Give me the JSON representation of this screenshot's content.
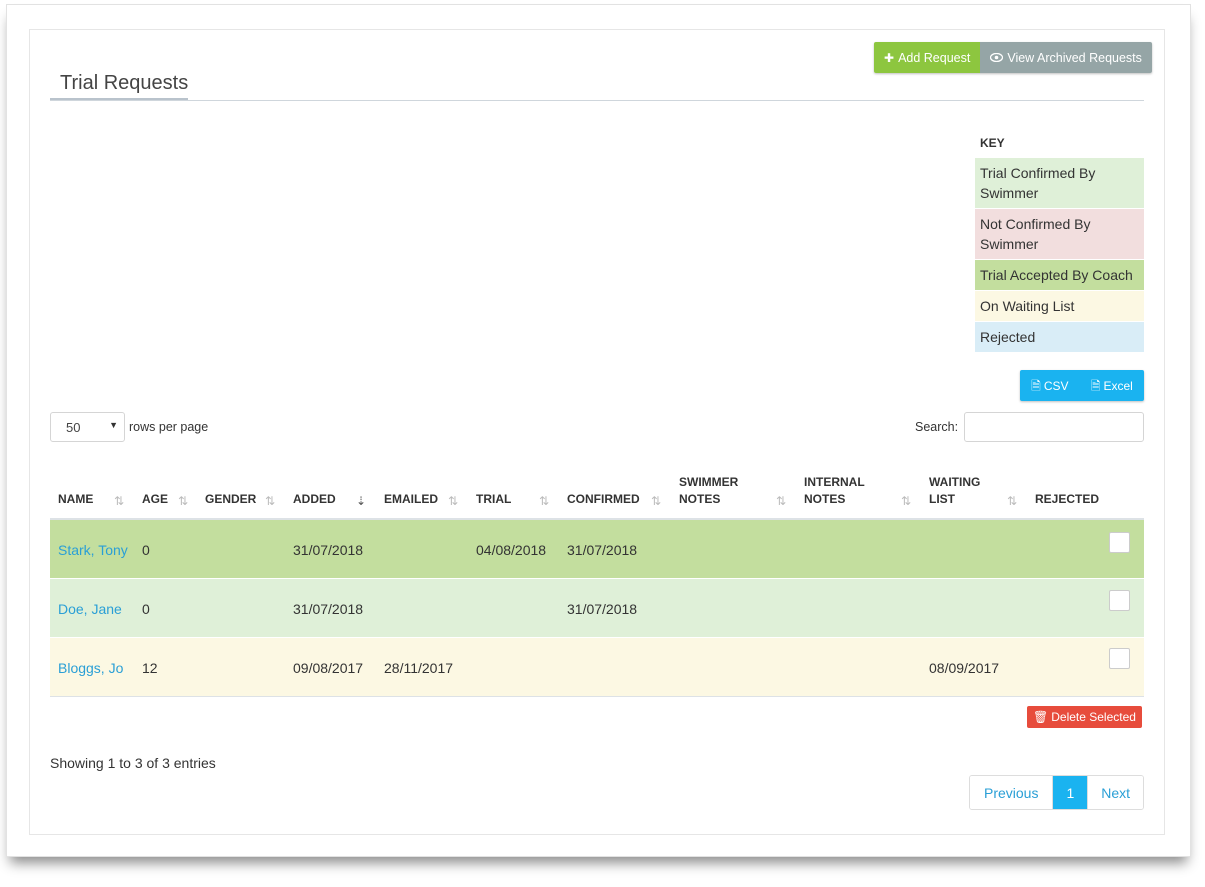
{
  "header": {
    "title": "Trial Requests",
    "add_request": "Add Request",
    "view_archived": "View Archived Requests"
  },
  "key": {
    "title": "KEY",
    "items": [
      {
        "label": "Trial Confirmed By Swimmer",
        "color": "#dff0d8"
      },
      {
        "label": "Not Confirmed By Swimmer",
        "color": "#f2dede"
      },
      {
        "label": "Trial Accepted By Coach",
        "color": "#c3de9e"
      },
      {
        "label": "On Waiting List",
        "color": "#fcf8e3"
      },
      {
        "label": "Rejected",
        "color": "#d9edf7"
      }
    ]
  },
  "export": {
    "csv": "CSV",
    "excel": "Excel"
  },
  "controls": {
    "rows_per_page_value": "50",
    "rows_per_page_label": "rows per page",
    "search_label": "Search:"
  },
  "table": {
    "columns": [
      "NAME",
      "AGE",
      "GENDER",
      "ADDED",
      "EMAILED",
      "TRIAL",
      "CONFIRMED",
      "SWIMMER NOTES",
      "INTERNAL NOTES",
      "WAITING LIST",
      "REJECTED"
    ],
    "rows": [
      {
        "name": "Stark, Tony",
        "age": "0",
        "gender": "",
        "added": "31/07/2018",
        "emailed": "",
        "trial": "04/08/2018",
        "confirmed": "31/07/2018",
        "swimmer_notes": "",
        "internal_notes": "",
        "waiting_list": "",
        "color": "#c3de9e"
      },
      {
        "name": "Doe, Jane",
        "age": "0",
        "gender": "",
        "added": "31/07/2018",
        "emailed": "",
        "trial": "",
        "confirmed": "31/07/2018",
        "swimmer_notes": "",
        "internal_notes": "",
        "waiting_list": "",
        "color": "#dff0d8"
      },
      {
        "name": "Bloggs, Jo",
        "age": "12",
        "gender": "",
        "added": "09/08/2017",
        "emailed": "28/11/2017",
        "trial": "",
        "confirmed": "",
        "swimmer_notes": "",
        "internal_notes": "",
        "waiting_list": "08/09/2017",
        "color": "#fcf8e3"
      }
    ]
  },
  "actions": {
    "delete_selected": "Delete Selected"
  },
  "footer": {
    "showing": "Showing 1 to 3 of 3 entries",
    "previous": "Previous",
    "page": "1",
    "next": "Next"
  }
}
